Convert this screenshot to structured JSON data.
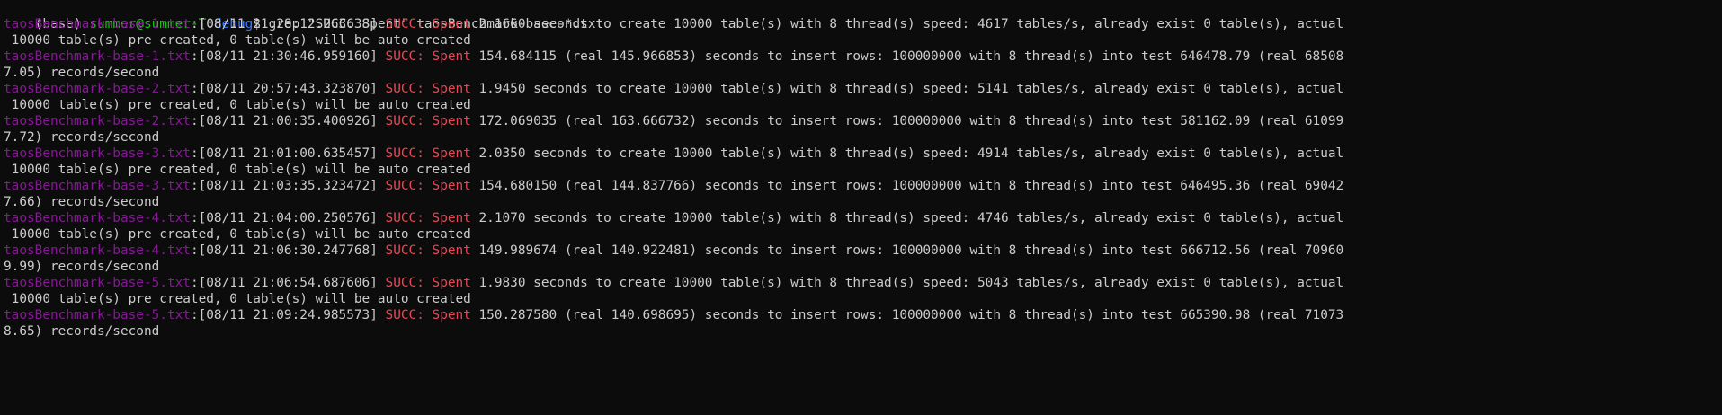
{
  "terminal": {
    "prompt": {
      "env": "(base) ",
      "user_host": "summer@summer-T",
      "colon": ":",
      "path": "debug",
      "symbol": "$ ",
      "command": "grep \"SUCC: Spent\" taosBenchmark-base-*.txt"
    },
    "colors": {
      "background": "#0c0c0c",
      "text": "#cccccc",
      "filename": "#881798",
      "match": "#e74856",
      "user_host": "#16c60c",
      "path": "#3b78ff"
    },
    "lines": [
      {
        "file": "taosBenchmark-base-1.txt",
        "sep": ":",
        "time": "[08/11 21:28:12.263638] ",
        "match": "SUCC: Spent",
        "rest": " 2.1660 seconds to create 10000 table(s) with 8 thread(s) speed: 4617 tables/s, already exist 0 table(s), actual"
      },
      {
        "text": " 10000 table(s) pre created, 0 table(s) will be auto created"
      },
      {
        "file": "taosBenchmark-base-1.txt",
        "sep": ":",
        "time": "[08/11 21:30:46.959160] ",
        "match": "SUCC: Spent",
        "rest": " 154.684115 (real 145.966853) seconds to insert rows: 100000000 with 8 thread(s) into test 646478.79 (real 68508"
      },
      {
        "text": "7.05) records/second"
      },
      {
        "file": "taosBenchmark-base-2.txt",
        "sep": ":",
        "time": "[08/11 20:57:43.323870] ",
        "match": "SUCC: Spent",
        "rest": " 1.9450 seconds to create 10000 table(s) with 8 thread(s) speed: 5141 tables/s, already exist 0 table(s), actual"
      },
      {
        "text": " 10000 table(s) pre created, 0 table(s) will be auto created"
      },
      {
        "file": "taosBenchmark-base-2.txt",
        "sep": ":",
        "time": "[08/11 21:00:35.400926] ",
        "match": "SUCC: Spent",
        "rest": " 172.069035 (real 163.666732) seconds to insert rows: 100000000 with 8 thread(s) into test 581162.09 (real 61099"
      },
      {
        "text": "7.72) records/second"
      },
      {
        "file": "taosBenchmark-base-3.txt",
        "sep": ":",
        "time": "[08/11 21:01:00.635457] ",
        "match": "SUCC: Spent",
        "rest": " 2.0350 seconds to create 10000 table(s) with 8 thread(s) speed: 4914 tables/s, already exist 0 table(s), actual"
      },
      {
        "text": " 10000 table(s) pre created, 0 table(s) will be auto created"
      },
      {
        "file": "taosBenchmark-base-3.txt",
        "sep": ":",
        "time": "[08/11 21:03:35.323472] ",
        "match": "SUCC: Spent",
        "rest": " 154.680150 (real 144.837766) seconds to insert rows: 100000000 with 8 thread(s) into test 646495.36 (real 69042"
      },
      {
        "text": "7.66) records/second"
      },
      {
        "file": "taosBenchmark-base-4.txt",
        "sep": ":",
        "time": "[08/11 21:04:00.250576] ",
        "match": "SUCC: Spent",
        "rest": " 2.1070 seconds to create 10000 table(s) with 8 thread(s) speed: 4746 tables/s, already exist 0 table(s), actual"
      },
      {
        "text": " 10000 table(s) pre created, 0 table(s) will be auto created"
      },
      {
        "file": "taosBenchmark-base-4.txt",
        "sep": ":",
        "time": "[08/11 21:06:30.247768] ",
        "match": "SUCC: Spent",
        "rest": " 149.989674 (real 140.922481) seconds to insert rows: 100000000 with 8 thread(s) into test 666712.56 (real 70960"
      },
      {
        "text": "9.99) records/second"
      },
      {
        "file": "taosBenchmark-base-5.txt",
        "sep": ":",
        "time": "[08/11 21:06:54.687606] ",
        "match": "SUCC: Spent",
        "rest": " 1.9830 seconds to create 10000 table(s) with 8 thread(s) speed: 5043 tables/s, already exist 0 table(s), actual"
      },
      {
        "text": " 10000 table(s) pre created, 0 table(s) will be auto created"
      },
      {
        "file": "taosBenchmark-base-5.txt",
        "sep": ":",
        "time": "[08/11 21:09:24.985573] ",
        "match": "SUCC: Spent",
        "rest": " 150.287580 (real 140.698695) seconds to insert rows: 100000000 with 8 thread(s) into test 665390.98 (real 71073"
      },
      {
        "text": "8.65) records/second"
      }
    ]
  }
}
